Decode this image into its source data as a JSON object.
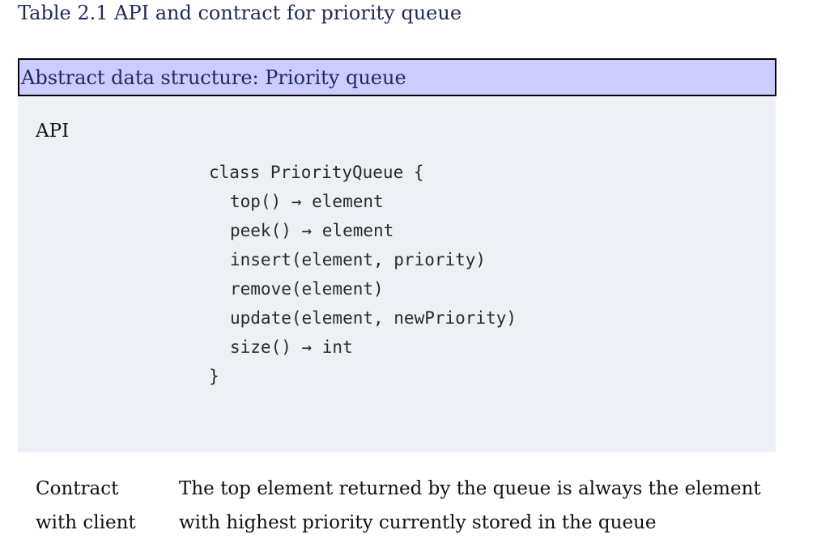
{
  "caption": "Table 2.1 API and contract for priority queue",
  "header": {
    "title": "Abstract data structure: Priority queue"
  },
  "api": {
    "label": "API",
    "code": {
      "open": "class PriorityQueue {",
      "methods": [
        "top() → element",
        "peek() → element",
        "insert(element, priority)",
        "remove(element)",
        "update(element, newPriority)",
        "size() → int"
      ],
      "close": "}"
    }
  },
  "contract": {
    "label_line1": "Contract",
    "label_line2": "with client",
    "text_line1": "The top element returned by the queue is always the element",
    "text_line2": "with highest priority currently stored in the queue"
  },
  "colors": {
    "header_background": "#cdccff",
    "api_background": "#edf0f4",
    "caption_text": "#1f2a5a"
  }
}
